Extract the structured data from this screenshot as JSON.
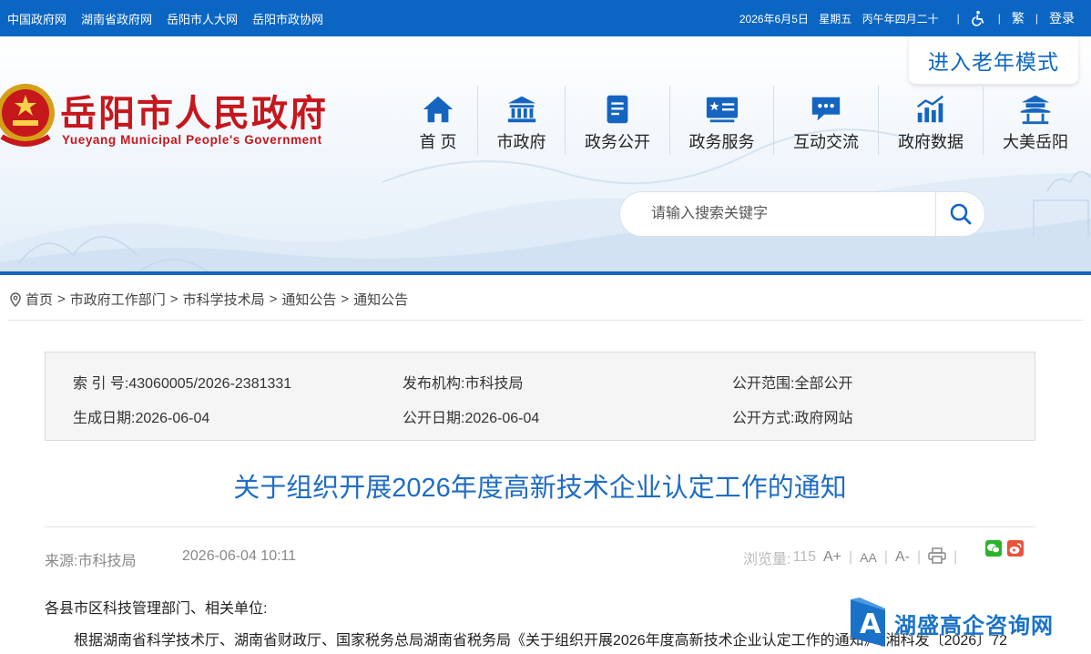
{
  "topbar": {
    "links": [
      "中国政府网",
      "湖南省政府网",
      "岳阳市人大网",
      "岳阳市政协网"
    ],
    "date": "2026年6月5日",
    "weekday": "星期五",
    "lunar": "丙午年四月二十",
    "traditional": "繁",
    "login": "登录",
    "accessibility_icon": "wheelchair-icon",
    "bg_color": "#0b66c3"
  },
  "header": {
    "title": "岳阳市人民政府",
    "subtitle": "Yueyang Municipal People's Government",
    "elder_mode": "进入老年模式",
    "title_color": "#c6171d"
  },
  "nav": [
    {
      "label": "首 页",
      "icon": "home-icon"
    },
    {
      "label": "市政府",
      "icon": "government-building-icon"
    },
    {
      "label": "政务公开",
      "icon": "document-icon"
    },
    {
      "label": "政务服务",
      "icon": "service-card-icon"
    },
    {
      "label": "互动交流",
      "icon": "chat-icon"
    },
    {
      "label": "政府数据",
      "icon": "chart-icon"
    },
    {
      "label": "大美岳阳",
      "icon": "pavilion-icon"
    }
  ],
  "search": {
    "placeholder": "请输入搜索关键字"
  },
  "breadcrumb": [
    "首页",
    "市政府工作部门",
    "市科学技术局",
    "通知公告",
    "通知公告"
  ],
  "info": {
    "index_label": "索 引 号:",
    "index_value": "43060005/2026-2381331",
    "publisher_label": "发布机构:",
    "publisher_value": "市科技局",
    "scope_label": "公开范围:",
    "scope_value": "全部公开",
    "created_label": "生成日期:",
    "created_value": "2026-06-04",
    "public_date_label": "公开日期:",
    "public_date_value": "2026-06-04",
    "method_label": "公开方式:",
    "method_value": "政府网站"
  },
  "article": {
    "title": "关于组织开展2026年度高新技术企业认定工作的通知",
    "source_label": "来源:",
    "source_value": "市科技局",
    "datetime": "2026-06-04 10:11",
    "views_label": "浏览量:",
    "views_value": "115",
    "font_larger": "A+",
    "font_normal": "AA",
    "font_smaller": "A-",
    "addressee": "各县市区科技管理部门、相关单位:",
    "para1": "根据湖南省科学技术厅、湖南省财政厅、国家税务总局湖南省税务局《关于组织开展2026年度高新技术企业认定工作的通知》【湘科发〔2026〕72"
  },
  "watermark": {
    "text": "湖盛高企咨询网",
    "logo_letter": "A"
  }
}
